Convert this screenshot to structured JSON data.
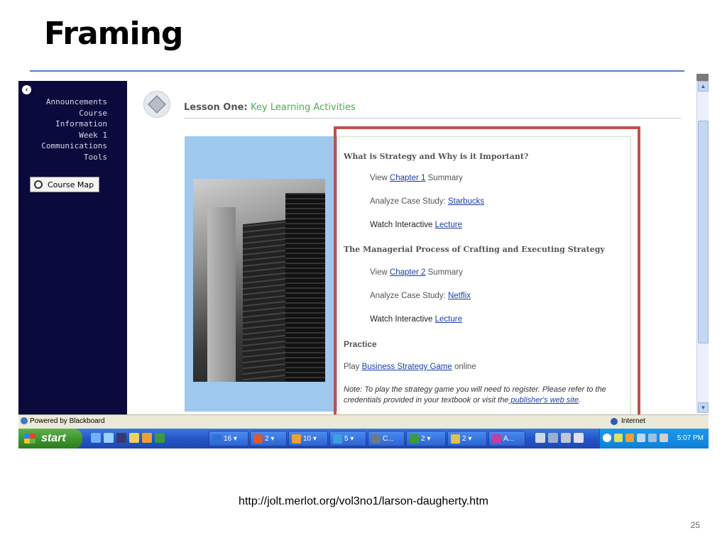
{
  "slide": {
    "title": "Framing",
    "caption_url": "http://jolt.merlot.org/vol3no1/larson-daugherty.htm",
    "page_number": "25",
    "accent_line_color": "#4f81bd",
    "highlight_color": "#c0504d"
  },
  "sidebar": {
    "back_icon": "back-arrow-icon",
    "items": [
      {
        "label": "Announcements"
      },
      {
        "label": "Course"
      },
      {
        "label": "Information"
      },
      {
        "label": "Week 1"
      },
      {
        "label": "Communications"
      },
      {
        "label": "Tools"
      }
    ],
    "course_map_label": "Course Map",
    "background": "#0a0a3c"
  },
  "lesson": {
    "title_prefix": "Lesson One:",
    "title_accent": "Key Learning Activities",
    "sections": [
      {
        "heading": "What is Strategy and Why is it Important?",
        "items": [
          {
            "pre": "View ",
            "link": "Chapter 1",
            "post": " Summary"
          },
          {
            "pre": "Analyze Case Study: ",
            "link": "Starbucks",
            "post": ""
          },
          {
            "pre": "Watch Interactive ",
            "link": "Lecture",
            "post": ""
          }
        ]
      },
      {
        "heading": "The Managerial Process of Crafting and Executing Strategy",
        "items": [
          {
            "pre": "View ",
            "link": "Chapter 2",
            "post": " Summary"
          },
          {
            "pre": "Analyze Case Study: ",
            "link": "Netflix",
            "post": ""
          },
          {
            "pre": "Watch Interactive ",
            "link": "Lecture",
            "post": ""
          }
        ]
      }
    ],
    "practice": {
      "heading": "Practice",
      "pre": "Play ",
      "link": "Business Strategy Game",
      "post": " online"
    },
    "note": {
      "text": "Note: To play the strategy game you will need to register. Please refer to the credentials provided in your textbook or visit the",
      "link": " publisher's web site",
      "end": "."
    }
  },
  "statusbar": {
    "left": "Powered by Blackboard",
    "right": "Internet"
  },
  "taskbar": {
    "start_label": "start",
    "buttons": [
      {
        "label": "16 ▾",
        "color": "#2f6fd6"
      },
      {
        "label": "2 ▾",
        "color": "#d65b2f"
      },
      {
        "label": "10 ▾",
        "color": "#f0a030"
      },
      {
        "label": "5 ▾",
        "color": "#3aa0e0"
      },
      {
        "label": "C...",
        "color": "#6a7a8a"
      },
      {
        "label": "2 ▾",
        "color": "#3c9a3c"
      },
      {
        "label": "2 ▾",
        "color": "#e0c050"
      },
      {
        "label": "A...",
        "color": "#c040a0"
      }
    ],
    "clock": "5:07 PM"
  }
}
